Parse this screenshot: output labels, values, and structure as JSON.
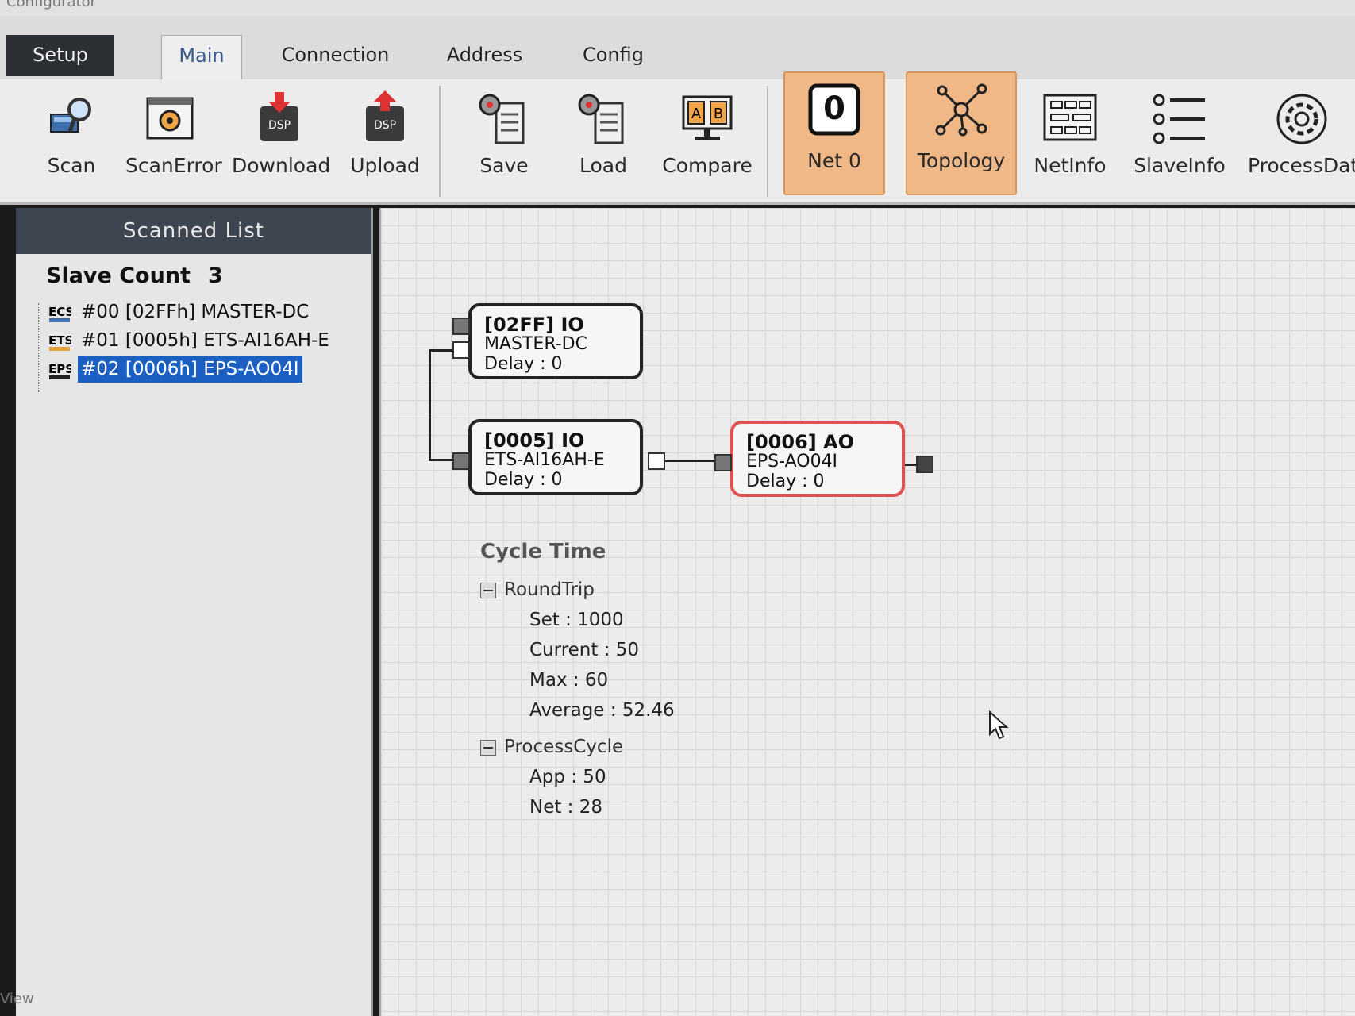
{
  "window": {
    "title": "Configurator"
  },
  "tabs": [
    {
      "label": "Setup"
    },
    {
      "label": "Main",
      "active": true
    },
    {
      "label": "Connection"
    },
    {
      "label": "Address"
    },
    {
      "label": "Config"
    }
  ],
  "ribbon": {
    "scan": "Scan",
    "scanerror": "ScanError",
    "download": "Download",
    "upload": "Upload",
    "save": "Save",
    "load": "Load",
    "compare": "Compare",
    "net_value": "0",
    "net_label": "Net 0",
    "topology": "Topology",
    "netinfo": "NetInfo",
    "slaveinfo": "SlaveInfo",
    "processdata": "ProcessDat",
    "dsp_badge": "DSP",
    "compare_a": "A",
    "compare_b": "B"
  },
  "scanned_list": {
    "title": "Scanned List",
    "slave_count_label": "Slave Count",
    "slave_count": "3",
    "items": [
      {
        "icon_text": "ECS",
        "label": "#00  [02FFh] MASTER-DC"
      },
      {
        "icon_text": "ETS",
        "label": "#01  [0005h] ETS-AI16AH-E"
      },
      {
        "icon_text": "EPS",
        "label": "#02  [0006h] EPS-AO04I",
        "selected": true
      }
    ]
  },
  "topology": {
    "nodes": [
      {
        "title": "[02FF] IO",
        "name": "MASTER-DC",
        "delay": "Delay : 0"
      },
      {
        "title": "[0005] IO",
        "name": "ETS-AI16AH-E",
        "delay": "Delay : 0"
      },
      {
        "title": "[0006] AO",
        "name": "EPS-AO04I",
        "delay": "Delay : 0"
      }
    ]
  },
  "cycle_time": {
    "title": "Cycle Time",
    "roundtrip": {
      "label": "RoundTrip",
      "set": "Set : 1000",
      "current": "Current : 50",
      "max": "Max : 60",
      "average": "Average : 52.46"
    },
    "processcycle": {
      "label": "ProcessCycle",
      "app": "App : 50",
      "net": "Net : 28"
    }
  },
  "status": {
    "left_text": "View"
  },
  "colors": {
    "highlight": "#f0b886",
    "selection": "#1b5fc2",
    "error_node": "#e05252"
  }
}
